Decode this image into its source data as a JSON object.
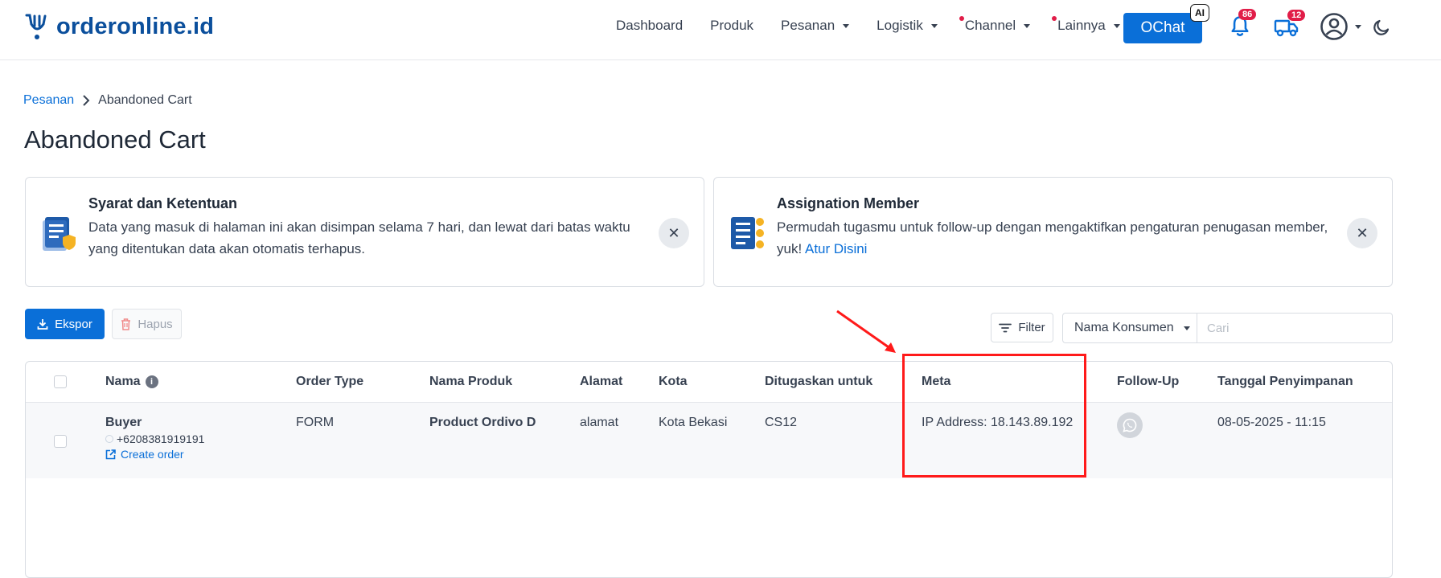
{
  "brand": {
    "name": "orderonline.id"
  },
  "nav": [
    {
      "label": "Dashboard"
    },
    {
      "label": "Produk"
    },
    {
      "label": "Pesanan"
    },
    {
      "label": "Logistik"
    },
    {
      "label": "Channel"
    },
    {
      "label": "Lainnya"
    }
  ],
  "header": {
    "ochat_label": "OChat",
    "ai_badge": "AI",
    "notification_count": "86",
    "shipping_count": "12"
  },
  "breadcrumb": {
    "parent": "Pesanan",
    "current": "Abandoned Cart"
  },
  "page_title": "Abandoned Cart",
  "cards": [
    {
      "title": "Syarat dan Ketentuan",
      "text": "Data yang masuk di halaman ini akan disimpan selama 7 hari, dan lewat dari batas waktu yang ditentukan data akan otomatis terhapus."
    },
    {
      "title": "Assignation Member",
      "text": "Permudah tugasmu untuk follow-up dengan mengaktifkan pengaturan penugasan member, yuk!",
      "link": "Atur Disini"
    }
  ],
  "toolbar": {
    "export_label": "Ekspor",
    "delete_label": "Hapus",
    "filter_label": "Filter",
    "search_by": "Nama Konsumen",
    "search_placeholder": "Cari"
  },
  "table": {
    "headers": {
      "nama": "Nama",
      "order_type": "Order Type",
      "nama_produk": "Nama Produk",
      "alamat": "Alamat",
      "kota": "Kota",
      "ditugaskan": "Ditugaskan untuk",
      "meta": "Meta",
      "follow_up": "Follow-Up",
      "tanggal": "Tanggal Penyimpanan"
    },
    "rows": [
      {
        "name": "Buyer",
        "phone": "+6208381919191",
        "create_order": "Create order",
        "order_type": "FORM",
        "product": "Product Ordivo D",
        "address": "alamat",
        "city": "Kota Bekasi",
        "assigned": "CS12",
        "meta": "IP Address: 18.143.89.192",
        "date": "08-05-2025 - 11:15"
      }
    ]
  },
  "colors": {
    "primary": "#0a6fd8",
    "brand": "#0b4f9c",
    "badge": "#e11d48",
    "annotation": "#ff1a1a"
  }
}
